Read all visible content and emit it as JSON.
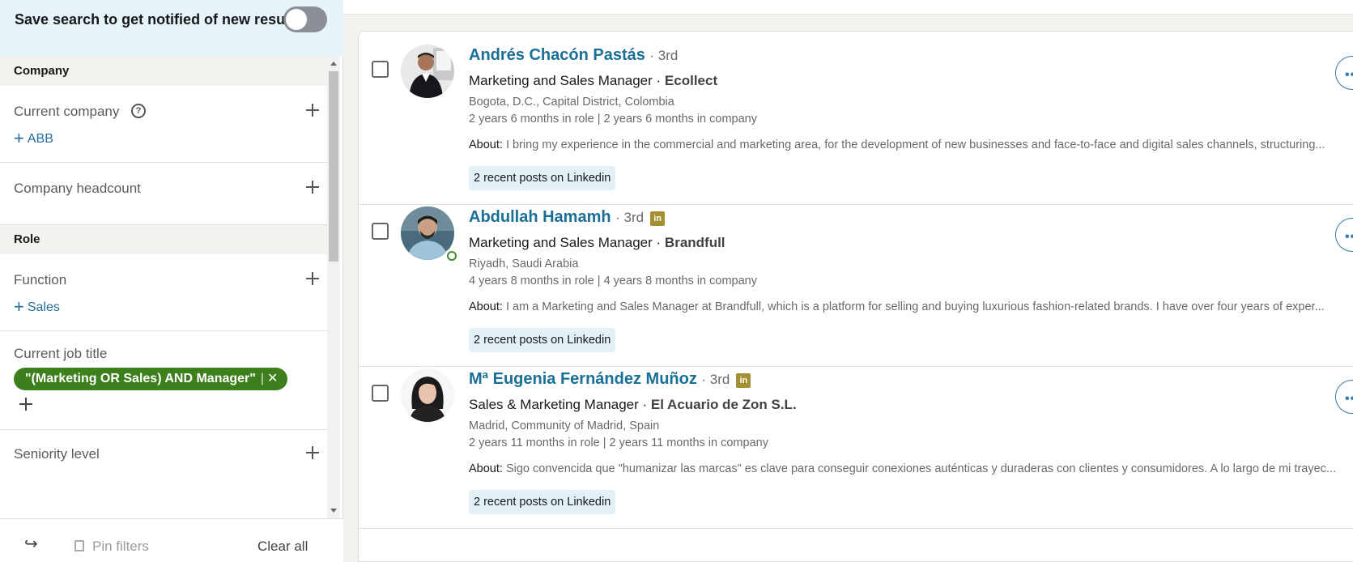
{
  "sidebar": {
    "save_search_text": "Save search to get notified of new resu...",
    "save_search_toggle_on": false,
    "sections": {
      "company": "Company",
      "role": "Role"
    },
    "filters": {
      "current_company": {
        "label": "Current company",
        "value": "ABB"
      },
      "company_headcount": {
        "label": "Company headcount"
      },
      "function": {
        "label": "Function",
        "value": "Sales"
      },
      "current_job_title": {
        "label": "Current job title",
        "value": "\"(Marketing OR Sales) AND Manager\""
      },
      "seniority_level": {
        "label": "Seniority level"
      }
    },
    "footer": {
      "pin_filters": "Pin filters",
      "clear_all": "Clear all"
    }
  },
  "results": [
    {
      "name": "Andrés Chacón Pastás",
      "degree": "· 3rd",
      "linkedin_badge": false,
      "online": false,
      "title": "Marketing and Sales Manager ·",
      "company": "Ecollect",
      "location": "Bogota, D.C., Capital District, Colombia",
      "tenure": "2 years 6 months in role | 2 years 6 months in company",
      "about_label": "About:",
      "about": "I bring my experience in the commercial and marketing area, for the development of new businesses and face-to-face and digital sales channels, structuring...",
      "posts": "2 recent posts on Linkedin"
    },
    {
      "name": "Abdullah Hamamh",
      "degree": "· 3rd",
      "linkedin_badge": true,
      "online": true,
      "title": "Marketing and Sales Manager ·",
      "company": "Brandfull",
      "location": "Riyadh, Saudi Arabia",
      "tenure": "4 years 8 months in role | 4 years 8 months in company",
      "about_label": "About:",
      "about": "I am a Marketing and Sales Manager at Brandfull, which is a platform for selling and buying luxurious fashion-related brands. I have over four years of exper...",
      "posts": "2 recent posts on Linkedin"
    },
    {
      "name": "Mª Eugenia Fernández Muñoz",
      "degree": "· 3rd",
      "linkedin_badge": true,
      "online": false,
      "title": "Sales & Marketing Manager ·",
      "company": "El Acuario de Zon S.L.",
      "location": "Madrid, Community of Madrid, Spain",
      "tenure": "2 years 11 months in role | 2 years 11 months in company",
      "about_label": "About:",
      "about": "Sigo convencida que \"humanizar las marcas\" es clave para conseguir conexiones auténticas y duraderas con clientes y consumidores. A lo largo de mi trayec...",
      "posts": "2 recent posts on Linkedin"
    }
  ],
  "icons": {
    "help": "help-circle-icon",
    "add": "plus-icon",
    "remove": "close-icon",
    "share": "share-icon",
    "pin": "pin-icon",
    "linkedin": "linkedin-icon",
    "more": "more-options-icon"
  },
  "colors": {
    "accent_link": "#1a6f96",
    "pill_bg": "#3d7e1d",
    "save_bar_bg": "#e6f3f8",
    "posts_chip_bg": "#e2f0f7",
    "linkedin_badge": "#a48f32",
    "online": "#3f8a2a"
  }
}
